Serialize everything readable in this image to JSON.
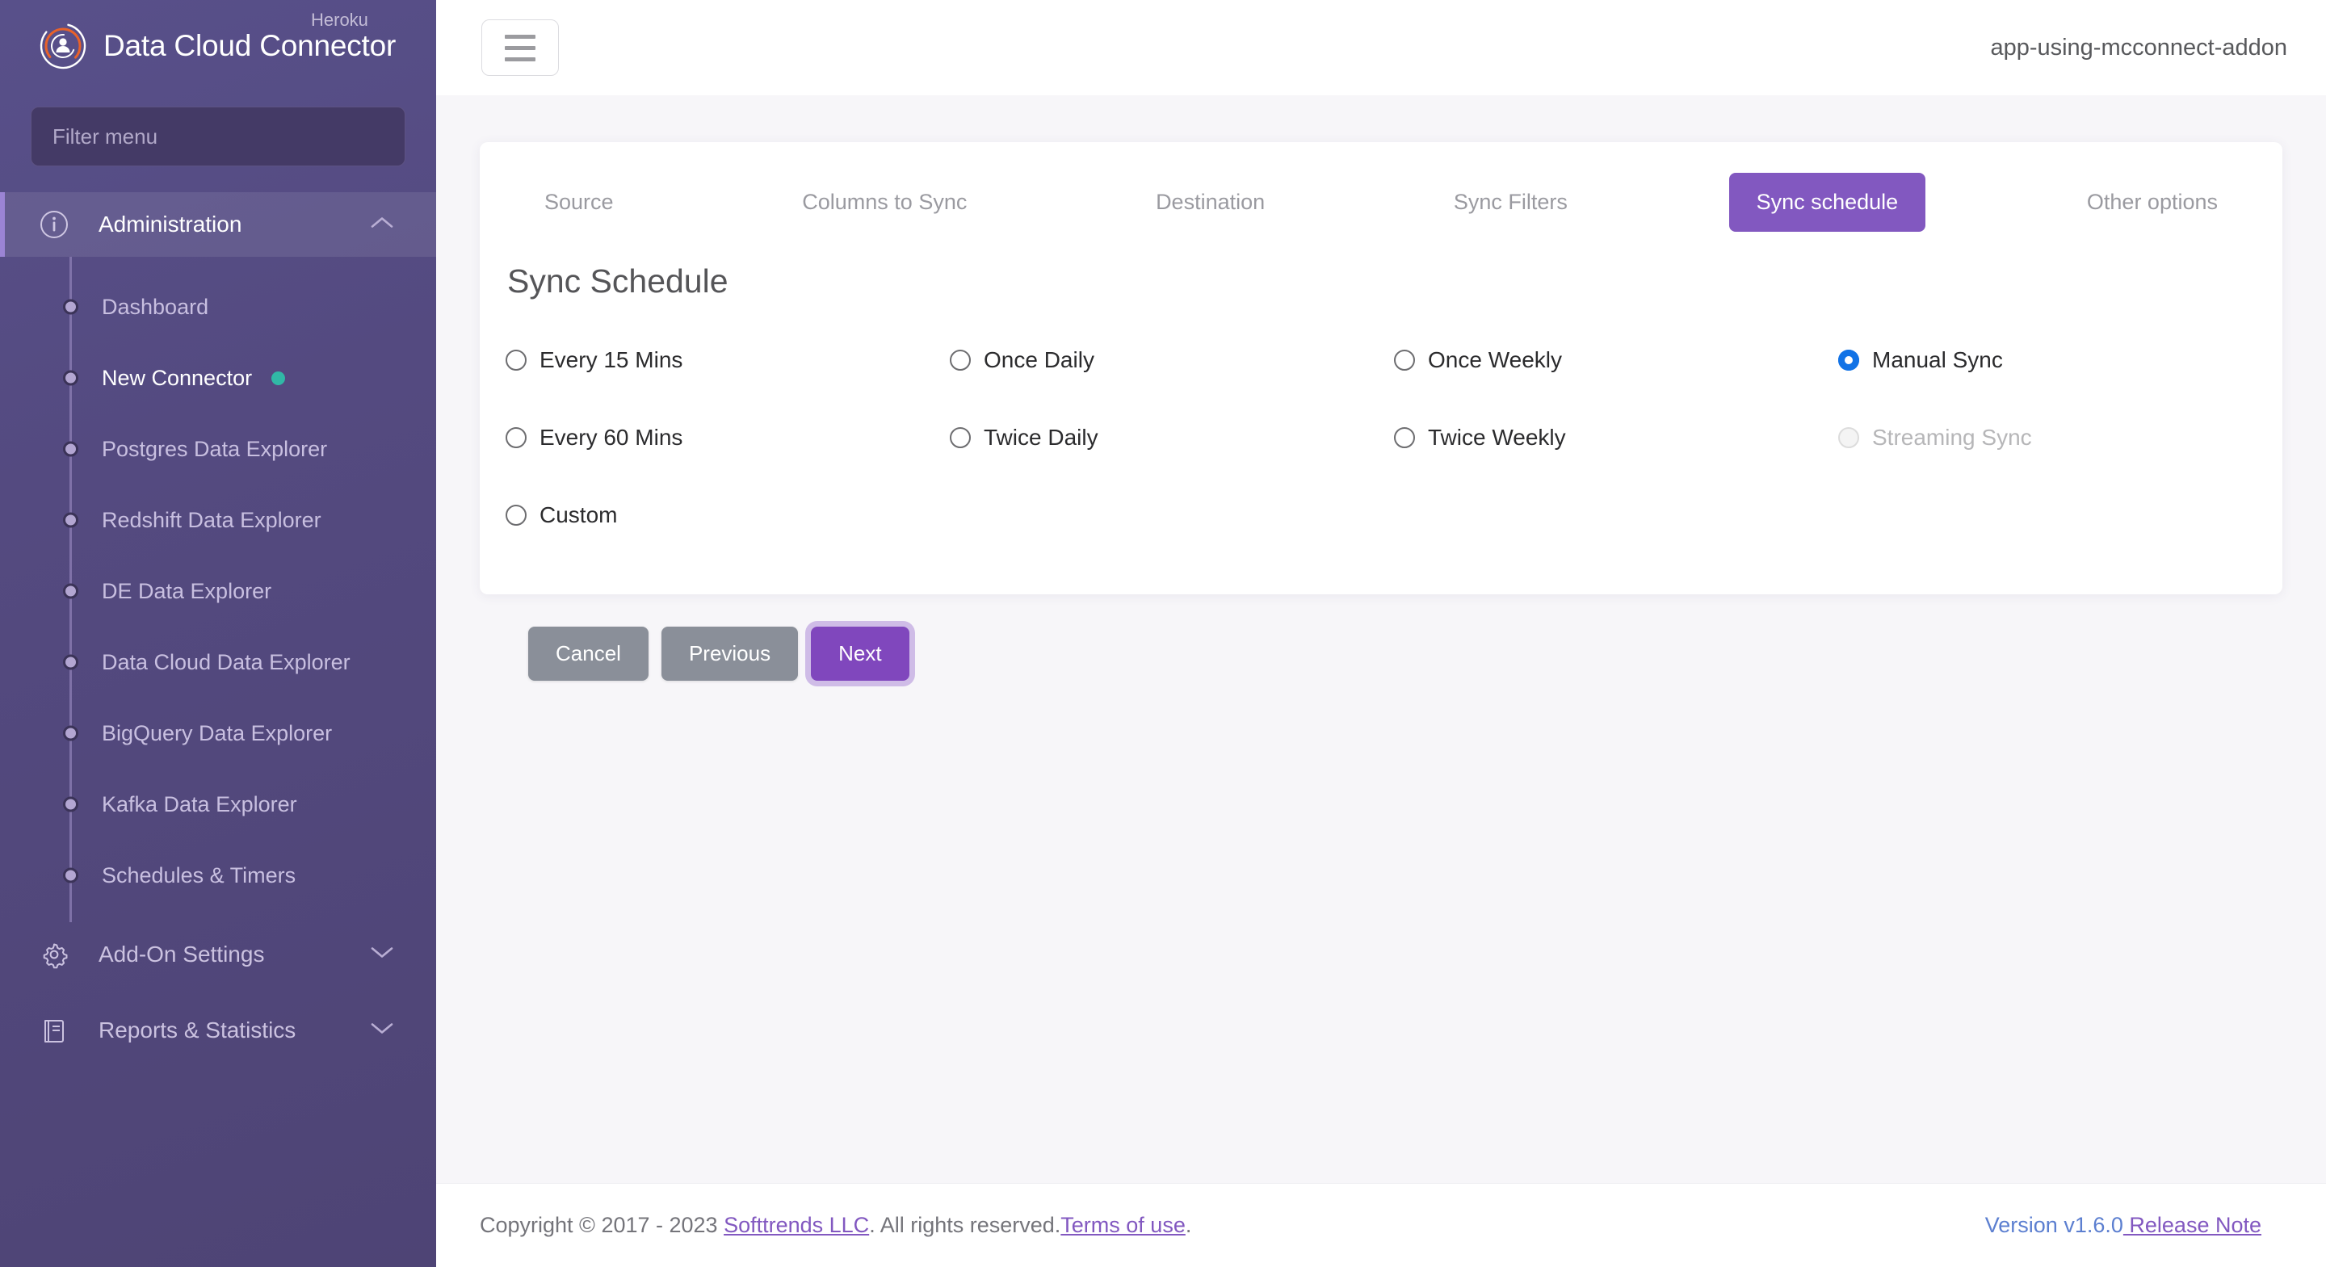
{
  "brand": {
    "title": "Data Cloud Connector",
    "superscript": "Heroku",
    "logo_icon": "user-circle-logo-icon"
  },
  "sidebar": {
    "filter": {
      "placeholder": "Filter menu",
      "value": ""
    },
    "groups": [
      {
        "label": "Administration",
        "icon": "info-circle-icon",
        "chevron": "chevron-up-icon",
        "active": true,
        "items": [
          {
            "label": "Dashboard",
            "selected": false,
            "status_dot": false
          },
          {
            "label": "New Connector",
            "selected": true,
            "status_dot": true
          },
          {
            "label": "Postgres Data Explorer",
            "selected": false,
            "status_dot": false
          },
          {
            "label": "Redshift Data Explorer",
            "selected": false,
            "status_dot": false
          },
          {
            "label": "DE Data Explorer",
            "selected": false,
            "status_dot": false
          },
          {
            "label": "Data Cloud Data Explorer",
            "selected": false,
            "status_dot": false
          },
          {
            "label": "BigQuery Data Explorer",
            "selected": false,
            "status_dot": false
          },
          {
            "label": "Kafka Data Explorer",
            "selected": false,
            "status_dot": false
          },
          {
            "label": "Schedules & Timers",
            "selected": false,
            "status_dot": false
          }
        ]
      },
      {
        "label": "Add-On Settings",
        "icon": "gear-icon",
        "chevron": "chevron-down-icon",
        "active": false,
        "items": []
      },
      {
        "label": "Reports & Statistics",
        "icon": "book-icon",
        "chevron": "chevron-down-icon",
        "active": false,
        "items": []
      }
    ]
  },
  "topbar": {
    "menu_icon": "hamburger-icon",
    "app_name": "app-using-mcconnect-addon"
  },
  "wizard": {
    "tabs": [
      {
        "label": "Source",
        "active": false
      },
      {
        "label": "Columns to Sync",
        "active": false
      },
      {
        "label": "Destination",
        "active": false
      },
      {
        "label": "Sync Filters",
        "active": false
      },
      {
        "label": "Sync schedule",
        "active": true
      },
      {
        "label": "Other options",
        "active": false
      }
    ],
    "section_title": "Sync Schedule",
    "schedule_options": [
      {
        "label": "Every 15 Mins",
        "checked": false,
        "disabled": false
      },
      {
        "label": "Once Daily",
        "checked": false,
        "disabled": false
      },
      {
        "label": "Once Weekly",
        "checked": false,
        "disabled": false
      },
      {
        "label": "Manual Sync",
        "checked": true,
        "disabled": false
      },
      {
        "label": "Every 60 Mins",
        "checked": false,
        "disabled": false
      },
      {
        "label": "Twice Daily",
        "checked": false,
        "disabled": false
      },
      {
        "label": "Twice Weekly",
        "checked": false,
        "disabled": false
      },
      {
        "label": "Streaming Sync",
        "checked": false,
        "disabled": true
      },
      {
        "label": "Custom",
        "checked": false,
        "disabled": false
      }
    ],
    "buttons": {
      "cancel": "Cancel",
      "previous": "Previous",
      "next": "Next"
    }
  },
  "footer": {
    "copyright_pre": "Copyright © 2017 - 2023 ",
    "company_link": "Softtrends LLC",
    "copyright_mid": ". All rights reserved.",
    "terms_link": "Terms of use",
    "copyright_end": ".",
    "version": "Version v1.6.0",
    "release_note_link": " Release Note"
  },
  "colors": {
    "accent_purple": "#8258c0",
    "sidebar_purple": "#544a80",
    "radio_blue": "#1273e6",
    "status_teal": "#31b8a6",
    "link_blue": "#5c7fd0"
  }
}
